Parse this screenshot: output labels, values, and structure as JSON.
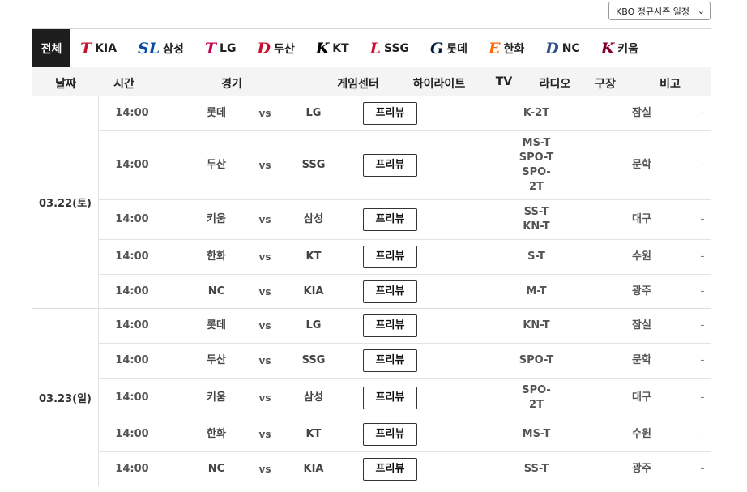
{
  "season_select": {
    "value": "KBO 정규시즌 일정"
  },
  "teams": {
    "all": "전체",
    "items": [
      {
        "logo": "T",
        "label": "KIA",
        "color": "#c8102e"
      },
      {
        "logo": "SL",
        "label": "삼성",
        "color": "#074ca1"
      },
      {
        "logo": "T",
        "label": "LG",
        "color": "#c30452"
      },
      {
        "logo": "D",
        "label": "두산",
        "color": "#c8102e"
      },
      {
        "logo": "K",
        "label": "KT",
        "color": "#000000"
      },
      {
        "logo": "L",
        "label": "SSG",
        "color": "#ce0e2d"
      },
      {
        "logo": "G",
        "label": "롯데",
        "color": "#041e42"
      },
      {
        "logo": "E",
        "label": "한화",
        "color": "#ff6600"
      },
      {
        "logo": "D",
        "label": "NC",
        "color": "#315288"
      },
      {
        "logo": "K",
        "label": "키움",
        "color": "#820024"
      }
    ]
  },
  "headers": {
    "date": "날짜",
    "time": "시간",
    "game": "경기",
    "gamecenter": "게임센터",
    "highlight": "하이라이트",
    "tv": "TV",
    "radio": "라디오",
    "stadium": "구장",
    "etc": "비고"
  },
  "days": [
    {
      "date": "03.22(토)",
      "games": [
        {
          "time": "14:00",
          "away": "롯데",
          "vs": "vs",
          "home": "LG",
          "button": "프리뷰",
          "tv": [
            "K-2T"
          ],
          "stadium": "잠실",
          "etc": "-"
        },
        {
          "time": "14:00",
          "away": "두산",
          "vs": "vs",
          "home": "SSG",
          "button": "프리뷰",
          "tv": [
            "MS-T",
            "SPO-T",
            "SPO-",
            "2T"
          ],
          "stadium": "문학",
          "etc": "-"
        },
        {
          "time": "14:00",
          "away": "키움",
          "vs": "vs",
          "home": "삼성",
          "button": "프리뷰",
          "tv": [
            "SS-T",
            "KN-T"
          ],
          "stadium": "대구",
          "etc": "-"
        },
        {
          "time": "14:00",
          "away": "한화",
          "vs": "vs",
          "home": "KT",
          "button": "프리뷰",
          "tv": [
            "S-T"
          ],
          "stadium": "수원",
          "etc": "-"
        },
        {
          "time": "14:00",
          "away": "NC",
          "vs": "vs",
          "home": "KIA",
          "button": "프리뷰",
          "tv": [
            "M-T"
          ],
          "stadium": "광주",
          "etc": "-"
        }
      ]
    },
    {
      "date": "03.23(일)",
      "games": [
        {
          "time": "14:00",
          "away": "롯데",
          "vs": "vs",
          "home": "LG",
          "button": "프리뷰",
          "tv": [
            "KN-T"
          ],
          "stadium": "잠실",
          "etc": "-"
        },
        {
          "time": "14:00",
          "away": "두산",
          "vs": "vs",
          "home": "SSG",
          "button": "프리뷰",
          "tv": [
            "SPO-T"
          ],
          "stadium": "문학",
          "etc": "-"
        },
        {
          "time": "14:00",
          "away": "키움",
          "vs": "vs",
          "home": "삼성",
          "button": "프리뷰",
          "tv": [
            "SPO-",
            "2T"
          ],
          "stadium": "대구",
          "etc": "-"
        },
        {
          "time": "14:00",
          "away": "한화",
          "vs": "vs",
          "home": "KT",
          "button": "프리뷰",
          "tv": [
            "MS-T"
          ],
          "stadium": "수원",
          "etc": "-"
        },
        {
          "time": "14:00",
          "away": "NC",
          "vs": "vs",
          "home": "KIA",
          "button": "프리뷰",
          "tv": [
            "SS-T"
          ],
          "stadium": "광주",
          "etc": "-"
        }
      ]
    }
  ]
}
